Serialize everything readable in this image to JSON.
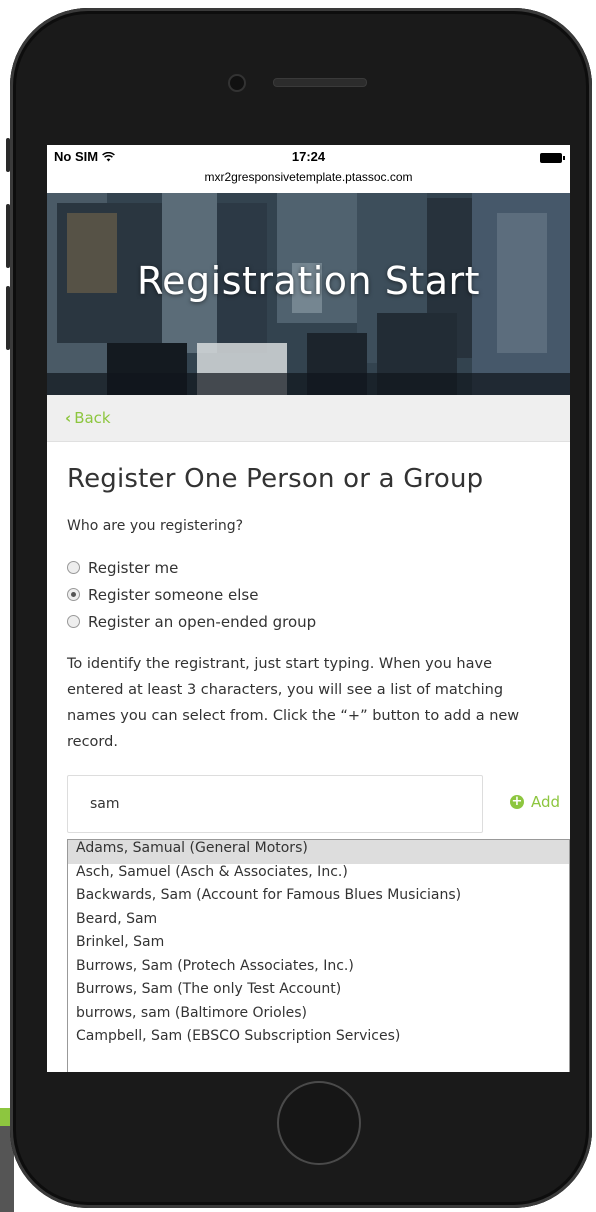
{
  "status_bar": {
    "carrier": "No SIM",
    "time": "17:24",
    "url": "mxr2gresponsivetemplate.ptassoc.com"
  },
  "hero": {
    "title": "Registration Start"
  },
  "nav": {
    "back_label": "Back"
  },
  "page": {
    "title": "Register One Person or a Group",
    "question": "Who are you registering?",
    "options": [
      {
        "label": "Register me",
        "selected": false
      },
      {
        "label": "Register someone else",
        "selected": true
      },
      {
        "label": "Register an open-ended group",
        "selected": false
      }
    ],
    "instructions": "To identify the registrant, just start typing. When you have entered at least 3 characters, you will see a list of matching names you can select from.  Click the “+” button to add a new record."
  },
  "search": {
    "value": "sam",
    "add_label": "Add"
  },
  "results": [
    "Adams, Samual (General Motors)",
    "Asch, Samuel (Asch & Associates, Inc.)",
    "Backwards, Sam (Account for Famous Blues Musicians)",
    "Beard, Sam",
    "Brinkel, Sam",
    "Burrows, Sam (Protech Associates, Inc.)",
    "Burrows, Sam (The only Test Account)",
    "burrows, sam (Baltimore Orioles)",
    "Campbell, Sam (EBSCO Subscription Services)"
  ],
  "colors": {
    "accent": "#8dc63f",
    "text": "#333333",
    "highlight": "#dddddd"
  }
}
